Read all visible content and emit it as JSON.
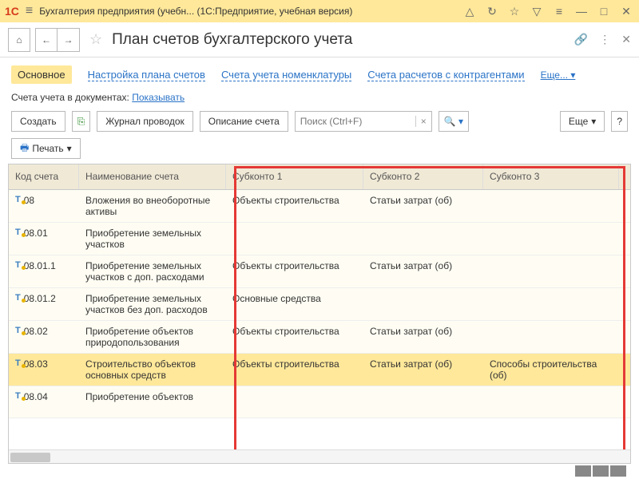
{
  "titlebar": {
    "logo": "1C",
    "title": "Бухгалтерия предприятия (учебн...   (1С:Предприятие, учебная версия)"
  },
  "page": {
    "title": "План счетов бухгалтерского учета"
  },
  "tabs": {
    "main": "Основное",
    "config": "Настройка плана счетов",
    "nomen": "Счета учета номенклатуры",
    "contr": "Счета расчетов с контрагентами",
    "more": "Еще..."
  },
  "line2": {
    "label": "Счета учета в документах:",
    "link": "Показывать"
  },
  "toolbar": {
    "create": "Создать",
    "journal": "Журнал проводок",
    "desc": "Описание счета",
    "search_placeholder": "Поиск (Ctrl+F)",
    "more": "Еще",
    "print": "Печать"
  },
  "grid": {
    "headers": {
      "code": "Код счета",
      "name": "Наименование счета",
      "s1": "Субконто 1",
      "s2": "Субконто 2",
      "s3": "Субконто 3"
    },
    "rows": [
      {
        "code": "08",
        "name": "Вложения во внеоборотные активы",
        "s1": "Объекты строительства",
        "s2": "Статьи затрат (об)",
        "s3": "",
        "sel": false
      },
      {
        "code": "08.01",
        "name": "Приобретение земельных участков",
        "s1": "",
        "s2": "",
        "s3": "",
        "sel": false
      },
      {
        "code": "08.01.1",
        "name": "Приобретение земельных участков с доп. расходами",
        "s1": "Объекты строительства",
        "s2": "Статьи затрат (об)",
        "s3": "",
        "sel": false
      },
      {
        "code": "08.01.2",
        "name": "Приобретение земельных участков без доп. расходов",
        "s1": "Основные средства",
        "s2": "",
        "s3": "",
        "sel": false
      },
      {
        "code": "08.02",
        "name": "Приобретение объектов природопользования",
        "s1": "Объекты строительства",
        "s2": "Статьи затрат (об)",
        "s3": "",
        "sel": false
      },
      {
        "code": "08.03",
        "name": "Строительство объектов основных средств",
        "s1": "Объекты строительства",
        "s2": "Статьи затрат (об)",
        "s3": "Способы строительства (об)",
        "sel": true
      },
      {
        "code": "08.04",
        "name": "Приобретение объектов",
        "s1": "",
        "s2": "",
        "s3": "",
        "sel": false
      }
    ]
  }
}
